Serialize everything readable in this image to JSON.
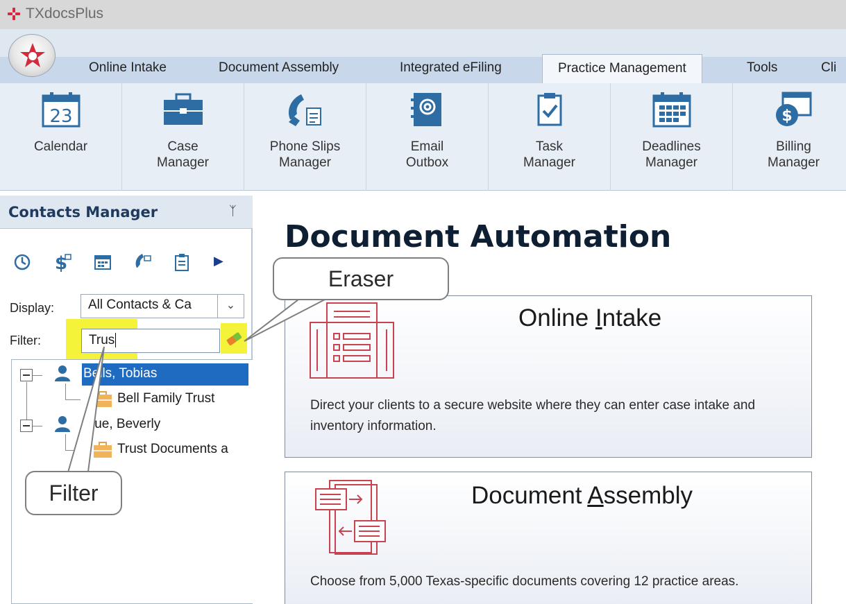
{
  "app": {
    "title": "TXdocsPlus"
  },
  "ribbon_tabs": [
    {
      "label": "Online Intake"
    },
    {
      "label": "Document Assembly"
    },
    {
      "label": "Integrated eFiling"
    },
    {
      "label": "Practice Management",
      "active": true
    },
    {
      "label": "Tools"
    },
    {
      "label": "Cli"
    }
  ],
  "ribbon_buttons": [
    {
      "label": "Calendar",
      "icon": "calendar-icon",
      "day": "23"
    },
    {
      "label": "Case\nManager",
      "icon": "briefcase-icon"
    },
    {
      "label": "Phone Slips\nManager",
      "icon": "phone-icon"
    },
    {
      "label": "Email\nOutbox",
      "icon": "email-icon"
    },
    {
      "label": "Task\nManager",
      "icon": "task-icon"
    },
    {
      "label": "Deadlines\nManager",
      "icon": "deadlines-calendar-icon"
    },
    {
      "label": "Billing\nManager",
      "icon": "billing-icon"
    }
  ],
  "contacts_pane": {
    "title": "Contacts Manager",
    "pin_glyph": "ᛉ",
    "display_label": "Display:",
    "display_value": "All Contacts & Ca",
    "filter_label": "Filter:",
    "filter_value": "Trus",
    "tree": [
      {
        "label": "Bells, Tobias",
        "selected": true,
        "children": [
          {
            "label": "Bell Family Trust"
          }
        ]
      },
      {
        "label": "True, Beverly",
        "children": [
          {
            "label": "Trust Documents a"
          }
        ]
      }
    ],
    "display_caret": "⌄",
    "play_glyph": "▶"
  },
  "main": {
    "heading": "Document Automation",
    "cards": [
      {
        "title_pre": "Online ",
        "title_ul": "I",
        "title_post": "ntake",
        "desc": "Direct your clients to a secure website where they can enter case intake and inventory information."
      },
      {
        "title_pre": "Document ",
        "title_ul": "A",
        "title_post": "ssembly",
        "desc": "Choose from 5,000 Texas-specific documents covering 12 practice areas."
      }
    ]
  },
  "callouts": {
    "eraser": "Eraser",
    "filter": "Filter"
  },
  "colors": {
    "accent": "#1f6bc2",
    "highlight": "#f5f23a",
    "brand_red": "#d42a3c"
  }
}
